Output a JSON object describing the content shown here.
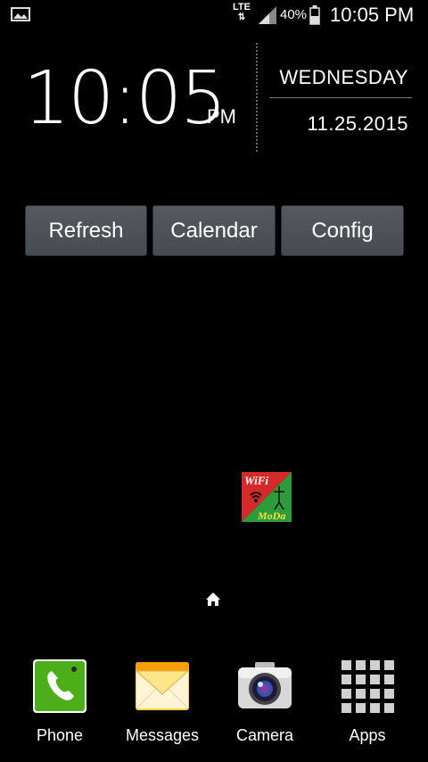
{
  "status_bar": {
    "network_type": "LTE",
    "battery_percent": "40%",
    "time": "10:05 PM",
    "icons": [
      "gallery-icon",
      "data-arrows-icon",
      "signal-icon",
      "battery-icon"
    ]
  },
  "clock_widget": {
    "time": "10:05",
    "ampm": "PM",
    "day": "WEDNESDAY",
    "date": "11.25.2015"
  },
  "widget_buttons": {
    "refresh": "Refresh",
    "calendar": "Calendar",
    "config": "Config"
  },
  "home_screen": {
    "wifi_moda_app": {
      "line1": "WiFi",
      "line2": "MoDa"
    },
    "current_page_icon": "home-icon"
  },
  "dock": [
    {
      "label": "Phone",
      "icon": "phone-icon"
    },
    {
      "label": "Messages",
      "icon": "messages-icon"
    },
    {
      "label": "Camera",
      "icon": "camera-icon"
    },
    {
      "label": "Apps",
      "icon": "apps-grid-icon"
    }
  ],
  "colors": {
    "background": "#000000",
    "button_bg": "#4e5258",
    "phone_green": "#4caf1a",
    "wifi_moda_red": "#d42a2a",
    "wifi_moda_green": "#2d9c3a"
  }
}
